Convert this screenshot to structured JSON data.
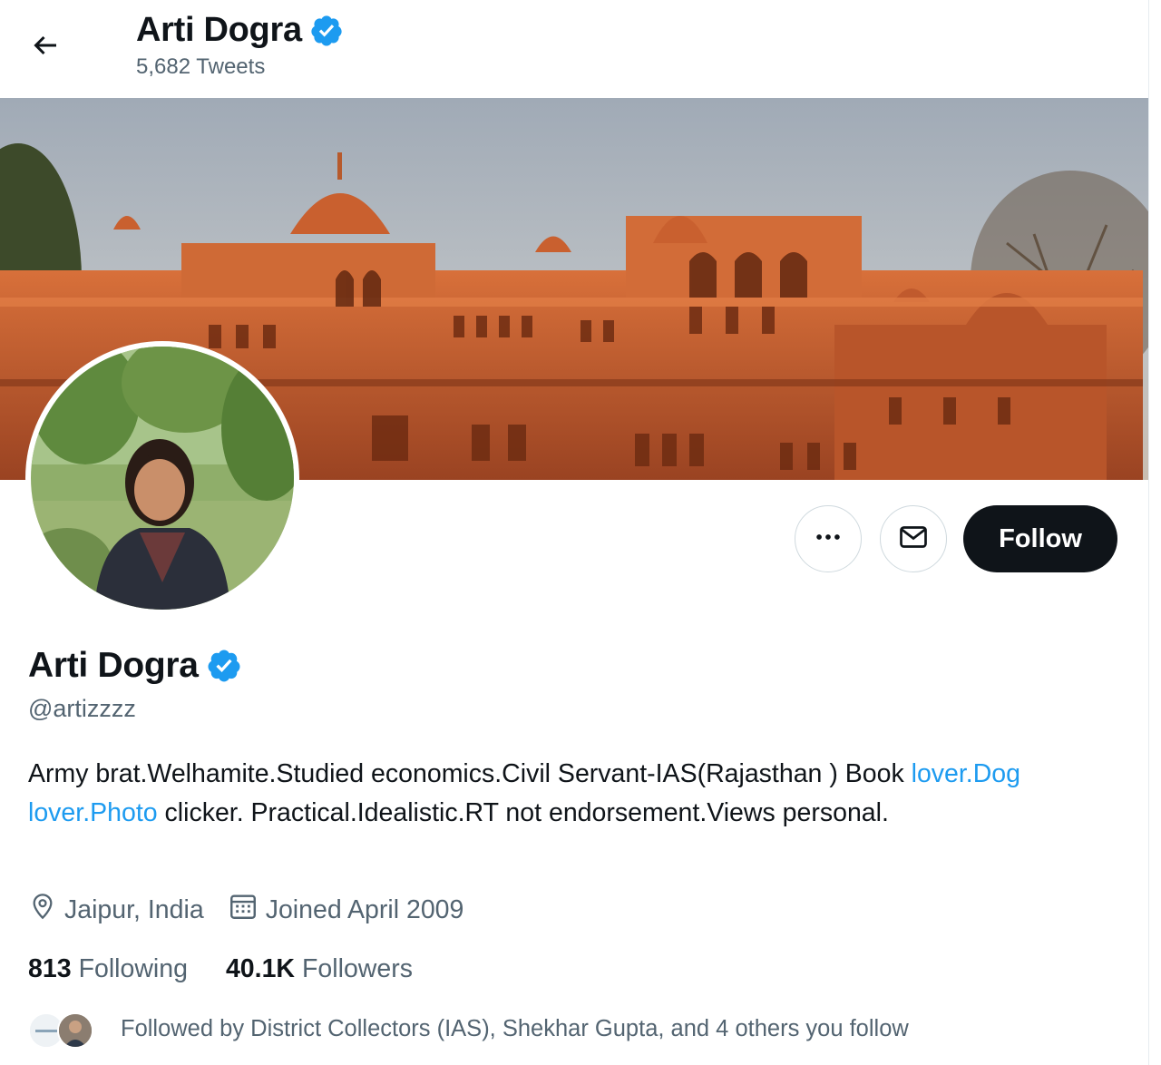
{
  "header": {
    "back_icon": "arrow-left-icon",
    "name": "Arti Dogra",
    "tweet_count": "5,682 Tweets"
  },
  "profile": {
    "name": "Arti Dogra",
    "handle": "@artizzzz",
    "verified_icon": "verified-badge-icon",
    "verified_color": "#1d9bf0",
    "bio": {
      "part1": "Army brat.Welhamite.Studied economics.Civil Servant-IAS(Rajasthan ) Book ",
      "link1": "lover.Dog",
      "space": " ",
      "link2": "lover.Photo",
      "part2": " clicker. Practical.Idealistic.RT not endorsement.Views personal."
    },
    "location": "Jaipur, India",
    "location_icon": "location-pin-icon",
    "joined": "Joined April 2009",
    "joined_icon": "calendar-icon"
  },
  "actions": {
    "more_icon": "more-icon",
    "message_icon": "envelope-icon",
    "follow_label": "Follow"
  },
  "stats": {
    "following_count": "813",
    "following_label": "Following",
    "followers_count": "40.1K",
    "followers_label": "Followers"
  },
  "followed_by": "Followed by District Collectors (IAS), Shekhar Gupta, and 4 others you follow",
  "colors": {
    "link": "#1d9bf0",
    "primary_text": "#0f1419",
    "secondary_text": "#536471",
    "follow_button_bg": "#0f1419"
  }
}
